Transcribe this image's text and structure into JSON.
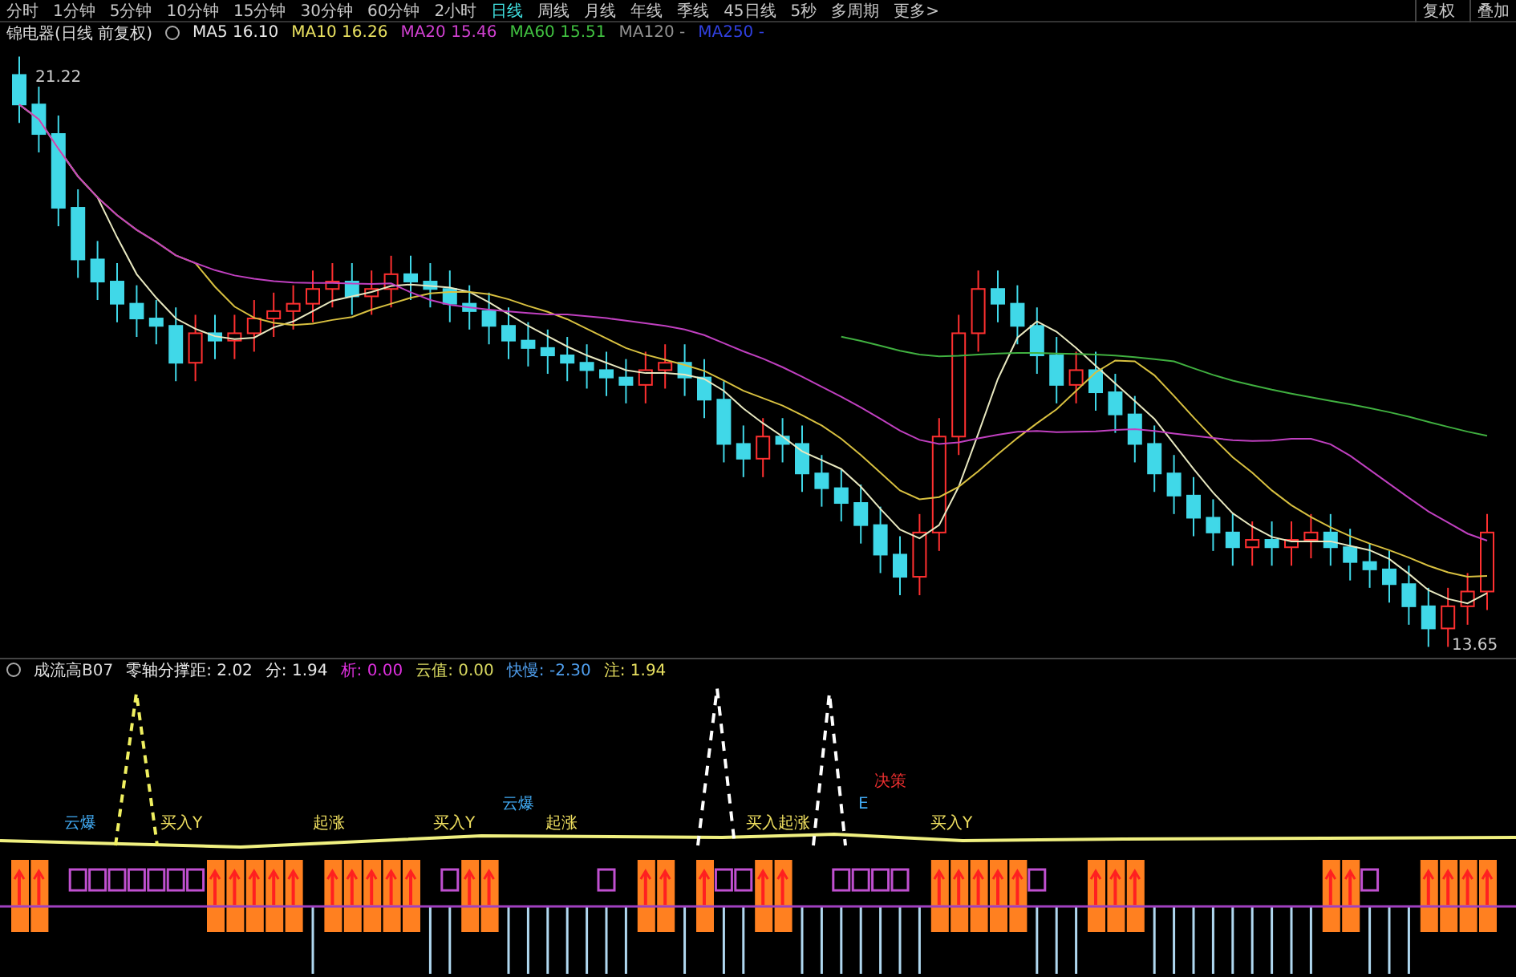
{
  "period_tabs": [
    {
      "label": "分时",
      "selected": false
    },
    {
      "label": "1分钟",
      "selected": false
    },
    {
      "label": "5分钟",
      "selected": false
    },
    {
      "label": "10分钟",
      "selected": false
    },
    {
      "label": "15分钟",
      "selected": false
    },
    {
      "label": "30分钟",
      "selected": false
    },
    {
      "label": "60分钟",
      "selected": false
    },
    {
      "label": "2小时",
      "selected": false
    },
    {
      "label": "日线",
      "selected": true
    },
    {
      "label": "周线",
      "selected": false
    },
    {
      "label": "月线",
      "selected": false
    },
    {
      "label": "年线",
      "selected": false
    },
    {
      "label": "季线",
      "selected": false
    },
    {
      "label": "45日线",
      "selected": false
    },
    {
      "label": "5秒",
      "selected": false
    },
    {
      "label": "多周期",
      "selected": false
    },
    {
      "label": "更多>",
      "selected": false
    }
  ],
  "toolbar_buttons": [
    "复权",
    "叠加"
  ],
  "chart_title": "锦电器(日线 前复权)",
  "ma_legend": [
    {
      "label": "MA5",
      "value": "16.10",
      "color": "#e8e8e8"
    },
    {
      "label": "MA10",
      "value": "16.26",
      "color": "#e8e060"
    },
    {
      "label": "MA20",
      "value": "15.46",
      "color": "#d040d0"
    },
    {
      "label": "MA60",
      "value": "15.51",
      "color": "#40c040"
    },
    {
      "label": "MA120",
      "value": "-",
      "color": "#909090"
    },
    {
      "label": "MA250",
      "value": "-",
      "color": "#3040e0"
    }
  ],
  "price_labels": {
    "high": "21.22",
    "low": "13.65"
  },
  "indicator": {
    "name": "成流高B07",
    "values": [
      {
        "label": "零轴分撑距:",
        "value": "2.02",
        "color": "#e8e8e8"
      },
      {
        "label": "分:",
        "value": "1.94",
        "color": "#e8e8e8"
      },
      {
        "label": "析:",
        "value": "0.00",
        "color": "#e030e0"
      },
      {
        "label": "云值:",
        "value": "0.00",
        "color": "#d8d860"
      },
      {
        "label": "快慢:",
        "value": "-2.30",
        "color": "#50a0f0"
      },
      {
        "label": "注:",
        "value": "1.94",
        "color": "#e8e060"
      }
    ]
  },
  "signals": [
    {
      "text": "云爆",
      "color": "#40a8f0"
    },
    {
      "text": "买入Y",
      "color": "#f0e060"
    },
    {
      "text": "起涨",
      "color": "#f0e060"
    },
    {
      "text": "买入Y",
      "color": "#f0e060"
    },
    {
      "text": "云爆",
      "color": "#40a8f0"
    },
    {
      "text": "起涨",
      "color": "#f0e060"
    },
    {
      "text": "买入起涨",
      "color": "#f0e060"
    },
    {
      "text": "E",
      "color": "#40a8f0"
    },
    {
      "text": "决策",
      "color": "#f03030"
    },
    {
      "text": "买入Y",
      "color": "#f0e060"
    }
  ]
}
